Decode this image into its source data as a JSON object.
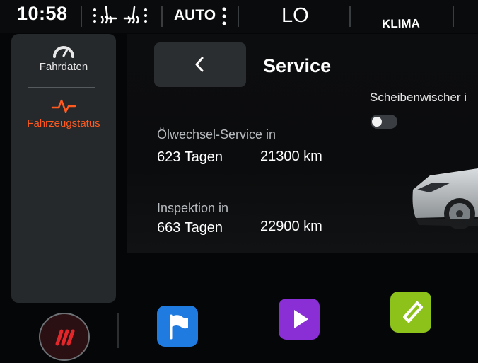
{
  "statusbar": {
    "time": "10:58",
    "seat_heating_icon": "seat-heating-icon",
    "auto_label": "AUTO",
    "temperature": "LO",
    "klima_label": "KLIMA"
  },
  "sidebar": {
    "items": [
      {
        "label": "Fahrdaten",
        "icon": "gauge-icon",
        "active": false
      },
      {
        "label": "Fahrzeugstatus",
        "icon": "heartbeat-icon",
        "active": true
      }
    ]
  },
  "header": {
    "back_icon": "chevron-left-icon",
    "title": "Service"
  },
  "service": {
    "oil": {
      "label": "Ölwechsel-Service in",
      "days": "623 Tagen",
      "km": "21300 km"
    },
    "inspection": {
      "label": "Inspektion in",
      "days": "663 Tagen",
      "km": "22900 km"
    }
  },
  "wiper": {
    "label": "Scheibenwischer i",
    "toggle_on": false
  },
  "dock": {
    "drive_mode_icon": "drive-mode-icon",
    "apps": [
      {
        "name": "navigation-flag-icon",
        "color": "#1f7be0"
      },
      {
        "name": "media-play-icon",
        "color": "#8a2fd6"
      },
      {
        "name": "phone-icon",
        "color": "#8cc21a"
      }
    ]
  },
  "colors": {
    "accent": "#ff5a1f",
    "panel": "#25292c",
    "background": "#050607"
  }
}
